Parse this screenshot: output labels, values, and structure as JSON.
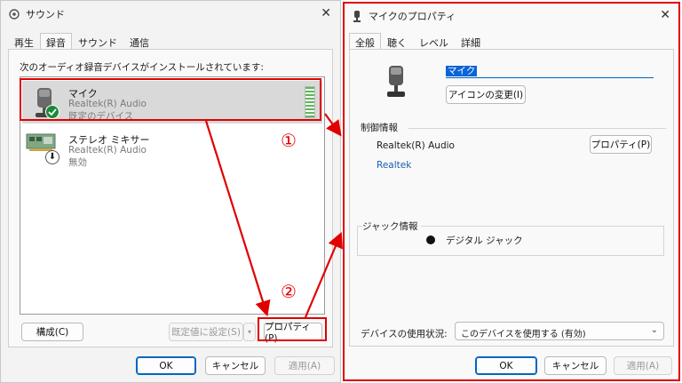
{
  "sound_dialog": {
    "title": "サウンド",
    "tabs": [
      "再生",
      "録音",
      "サウンド",
      "通信"
    ],
    "instruction": "次のオーディオ録音デバイスがインストールされています:",
    "devices": [
      {
        "name": "マイク",
        "driver": "Realtek(R) Audio",
        "status": "既定のデバイス"
      },
      {
        "name": "ステレオ ミキサー",
        "driver": "Realtek(R) Audio",
        "status": "無効"
      }
    ],
    "configure_label": "構成(C)",
    "set_default_label": "既定値に設定(S)",
    "properties_label": "プロパティ(P)",
    "ok_label": "OK",
    "cancel_label": "キャンセル",
    "apply_label": "適用(A)"
  },
  "mic_properties": {
    "title": "マイクのプロパティ",
    "tabs": [
      "全般",
      "聴く",
      "レベル",
      "詳細"
    ],
    "name_value": "マイク",
    "change_icon_label": "アイコンの変更(I)",
    "controller_group": "制御情報",
    "controller_name": "Realtek(R) Audio",
    "controller_props_label": "プロパティ(P)",
    "vendor_link": "Realtek",
    "jack_group": "ジャック情報",
    "jack_value": "デジタル ジャック",
    "usage_label": "デバイスの使用状況:",
    "usage_value": "このデバイスを使用する (有効)",
    "ok_label": "OK",
    "cancel_label": "キャンセル",
    "apply_label": "適用(A)"
  },
  "annotations": {
    "step1": "①",
    "step2": "②"
  },
  "colors": {
    "annotation_red": "#e10000",
    "link_blue": "#1a5fb4",
    "accent": "#0067c0",
    "default_check": "#1a8a3a"
  }
}
